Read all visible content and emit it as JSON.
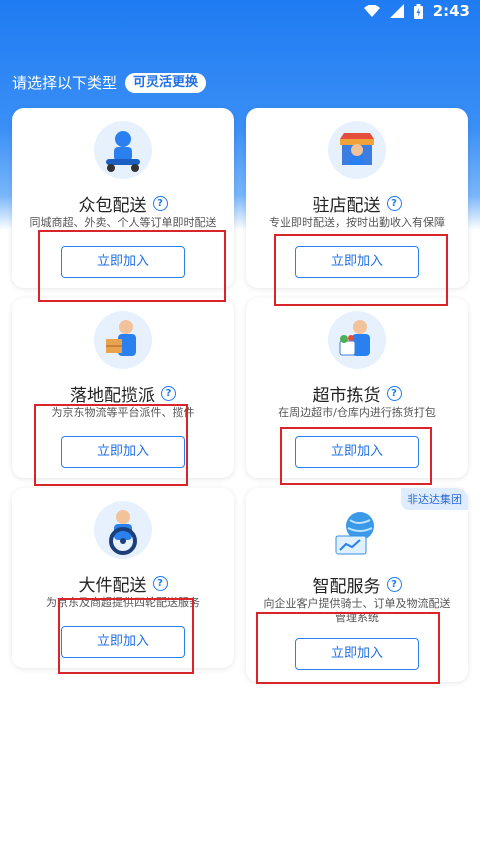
{
  "status_bar": {
    "time": "2:43"
  },
  "header": {
    "title": "请选择以下类型",
    "badge": "可灵活更换"
  },
  "cards": [
    {
      "name": "众包配送",
      "desc": "同城商超、外卖、个人等订单即时配送",
      "button": "立即加入"
    },
    {
      "name": "驻店配送",
      "desc": "专业即时配送，按时出勤收入有保障",
      "button": "立即加入"
    },
    {
      "name": "落地配揽派",
      "desc": "为京东物流等平台派件、揽件",
      "button": "立即加入"
    },
    {
      "name": "超市拣货",
      "desc": "在周边超市/仓库内进行拣货打包",
      "button": "立即加入"
    },
    {
      "name": "大件配送",
      "desc": "为京东及商超提供四轮配送服务",
      "button": "立即加入"
    },
    {
      "name": "智配服务",
      "desc": "向企业客户提供骑士、订单及物流配送管理系统",
      "button": "立即加入",
      "tag": "非达达集团"
    }
  ],
  "colors": {
    "primary": "#1f7bf2",
    "highlight": "#d9252a"
  }
}
